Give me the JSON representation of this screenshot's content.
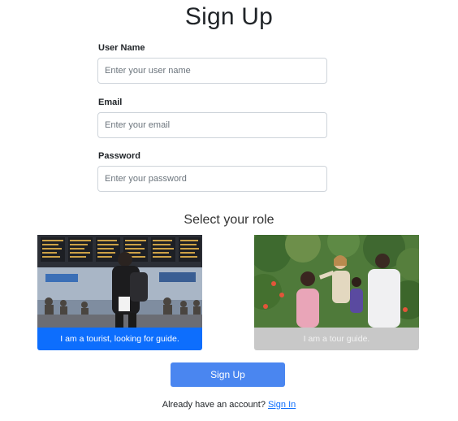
{
  "page": {
    "title": "Sign Up"
  },
  "form": {
    "username": {
      "label": "User Name",
      "placeholder": "Enter your user name",
      "value": ""
    },
    "email": {
      "label": "Email",
      "placeholder": "Enter your email",
      "value": ""
    },
    "password": {
      "label": "Password",
      "placeholder": "Enter your password",
      "value": ""
    }
  },
  "roles": {
    "title": "Select your role",
    "tourist": {
      "caption": "I am a tourist, looking for guide.",
      "selected": true,
      "color": "#0d6efd"
    },
    "guide": {
      "caption": "I am a tour guide.",
      "selected": false,
      "color": "#c8c8c8"
    }
  },
  "submit": {
    "label": "Sign Up",
    "color": "#4a86f0"
  },
  "footer": {
    "text": "Already have an account?",
    "link": "Sign In"
  }
}
